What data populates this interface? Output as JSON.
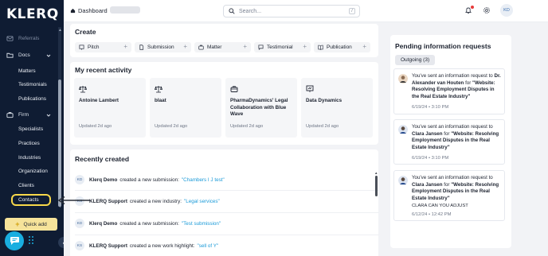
{
  "app": {
    "logo": "KLERQ"
  },
  "colors": {
    "sidebar_bg": "#0f1c33",
    "accent_yellow": "#f7d84a",
    "link_blue": "#1a9ad8",
    "chat_bubble": "#19aee0",
    "notification_dot": "#e63a3a"
  },
  "sidebar": {
    "referrals": "Referrals",
    "docs": {
      "label": "Docs",
      "items": [
        "Matters",
        "Testimonials",
        "Publications"
      ]
    },
    "firm": {
      "label": "Firm",
      "items": [
        "Specialists",
        "Practices",
        "Industries",
        "Organization",
        "Clients",
        "Contacts"
      ]
    },
    "quick_add": "Quick add",
    "icons": {
      "referrals": "mail-icon",
      "docs": "folder-icon",
      "firm": "briefcase-icon",
      "collapse": "chevron-left-icon",
      "chat": "chat-icon"
    }
  },
  "topbar": {
    "breadcrumb": "Dashboard",
    "search_placeholder": "Search...",
    "search_shortcut": "/",
    "user_initials": "KD",
    "icons": {
      "home": "home-icon",
      "search": "search-icon",
      "bell": "bell-icon",
      "settings": "gear-icon"
    }
  },
  "create": {
    "title": "Create",
    "buttons": [
      {
        "label": "Pitch",
        "icon": "pitch-icon"
      },
      {
        "label": "Submission",
        "icon": "document-icon"
      },
      {
        "label": "Matter",
        "icon": "briefcase-icon"
      },
      {
        "label": "Testimonial",
        "icon": "message-icon"
      },
      {
        "label": "Publication",
        "icon": "book-icon"
      }
    ],
    "plus": "+"
  },
  "recent_activity": {
    "title": "My recent activity",
    "items": [
      {
        "name": "Antoine Lambert",
        "updated": "Updated 2d ago",
        "icon": "scales-icon"
      },
      {
        "name": "blaat",
        "updated": "Updated 2d ago",
        "icon": "scales-icon"
      },
      {
        "name": "PharmaDynamics' Legal Collaboration with Blue Wave",
        "updated": "Updated 2d ago",
        "icon": "briefcase-icon"
      },
      {
        "name": "Data Dynamics",
        "updated": "Updated 2d ago",
        "icon": "presentation-icon"
      }
    ]
  },
  "recently_created": {
    "title": "Recently created",
    "rows": [
      {
        "initials": "KD",
        "actor": "Klerq Demo",
        "action": "created a new submission:",
        "target": "\"Chambers I J test\""
      },
      {
        "initials": "KS",
        "actor": "KLERQ Support",
        "action": "created a new industry:",
        "target": "\"Legal services\""
      },
      {
        "initials": "KD",
        "actor": "Klerq Demo",
        "action": "created a new submission:",
        "target": "\"Test submission\""
      },
      {
        "initials": "KS",
        "actor": "KLERQ Support",
        "action": "created a new work highlight:",
        "target": "\"sell of Y\""
      }
    ]
  },
  "pending": {
    "title": "Pending information requests",
    "tab": "Outgoing (3)",
    "items": [
      {
        "prefix": "You've sent an information request to",
        "person": "Dr. Alexander van Houten",
        "mid": "for",
        "subject": "\"Website: Resolving Employment Disputes in the Real Estate Industry\"",
        "date": "6/19/24 • 3:10 PM",
        "extra": ""
      },
      {
        "prefix": "You've sent an information request to",
        "person": "Clara Jansen",
        "mid": "for",
        "subject": "\"Website: Resolving Employment Disputes in the Real Estate Industry\"",
        "date": "6/19/24 • 3:10 PM",
        "extra": ""
      },
      {
        "prefix": "You've sent an information request to",
        "person": "Clara Jansen",
        "mid": "for",
        "subject": "\"Website: Resolving Employment Disputes in the Real Estate Industry\"",
        "date": "6/12/24 • 12:42 PM",
        "extra": "CLARA CAN YOU ADJUST"
      }
    ]
  }
}
